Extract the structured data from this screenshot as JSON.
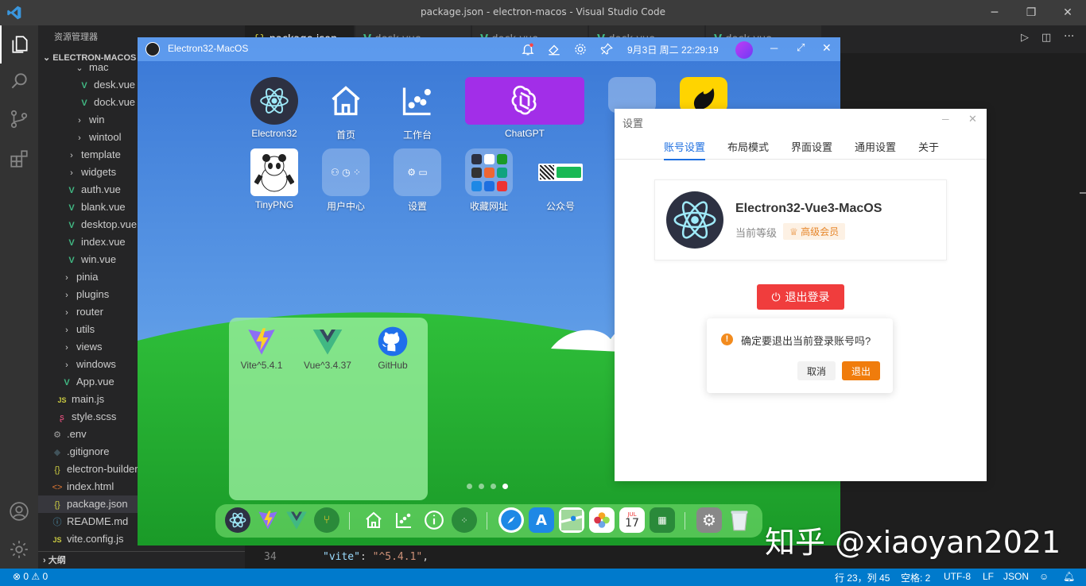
{
  "window": {
    "title": "package.json - electron-macos - Visual Studio Code"
  },
  "explorer": {
    "title": "资源管理器",
    "root": "ELECTRON-MACOS",
    "items": [
      {
        "label": "mac",
        "kind": "folder-open"
      },
      {
        "label": "desk.vue",
        "kind": "vue"
      },
      {
        "label": "dock.vue",
        "kind": "vue"
      },
      {
        "label": "win",
        "kind": "folder"
      },
      {
        "label": "wintool",
        "kind": "folder"
      },
      {
        "label": "template",
        "kind": "folder"
      },
      {
        "label": "widgets",
        "kind": "folder"
      },
      {
        "label": "auth.vue",
        "kind": "vue"
      },
      {
        "label": "blank.vue",
        "kind": "vue"
      },
      {
        "label": "desktop.vue",
        "kind": "vue"
      },
      {
        "label": "index.vue",
        "kind": "vue"
      },
      {
        "label": "win.vue",
        "kind": "vue"
      },
      {
        "label": "pinia",
        "kind": "folder"
      },
      {
        "label": "plugins",
        "kind": "folder"
      },
      {
        "label": "router",
        "kind": "folder"
      },
      {
        "label": "utils",
        "kind": "folder"
      },
      {
        "label": "views",
        "kind": "folder"
      },
      {
        "label": "windows",
        "kind": "folder"
      },
      {
        "label": "App.vue",
        "kind": "vue"
      },
      {
        "label": "main.js",
        "kind": "js"
      },
      {
        "label": "style.scss",
        "kind": "scss"
      },
      {
        "label": ".env",
        "kind": "gear"
      },
      {
        "label": ".gitignore",
        "kind": "git"
      },
      {
        "label": "electron-builder",
        "kind": "json"
      },
      {
        "label": "index.html",
        "kind": "html"
      },
      {
        "label": "package.json",
        "kind": "json"
      },
      {
        "label": "README.md",
        "kind": "info"
      },
      {
        "label": "vite.config.js",
        "kind": "js"
      }
    ],
    "outline": "大纲"
  },
  "editor": {
    "tabs": [
      "package.json",
      "desk.vue",
      "dock.vue",
      "dock.vue",
      "dock.vue"
    ],
    "line_number": "34",
    "line_key": "\"vite\"",
    "line_sep": ": ",
    "line_val": "\"^5.4.1\"",
    "line_end": ","
  },
  "status": {
    "errors": "⊗ 0 ⚠ 0",
    "position": "行 23，列 45",
    "spaces": "空格: 2",
    "encoding": "UTF-8",
    "eol": "LF",
    "language": "JSON"
  },
  "app": {
    "title": "Electron32-MacOS",
    "time": "9月3日 周二 22:29:19",
    "icons_row1": [
      "Electron32",
      "首页",
      "工作台",
      "ChatGPT"
    ],
    "icons_row2": [
      "TinyPNG",
      "用户中心",
      "设置",
      "收藏网址",
      "公众号"
    ],
    "widget": [
      "Vite^5.4.1",
      "Vue^3.4.37",
      "GitHub"
    ]
  },
  "settings": {
    "title": "设置",
    "tabs": [
      "账号设置",
      "布局模式",
      "界面设置",
      "通用设置",
      "关于"
    ],
    "name": "Electron32-Vue3-MacOS",
    "level_label": "当前等级",
    "badge": "高级会员",
    "logout": "退出登录"
  },
  "confirm": {
    "message": "确定要退出当前登录账号吗?",
    "cancel": "取消",
    "ok": "退出"
  },
  "watermark": "知乎 @xiaoyan2021",
  "colors": {
    "vscode_blue": "#007acc",
    "accent": "#1e6fe0",
    "danger": "#f03d3d",
    "warning": "#f07c0c",
    "chatgpt": "#a22ee8"
  }
}
